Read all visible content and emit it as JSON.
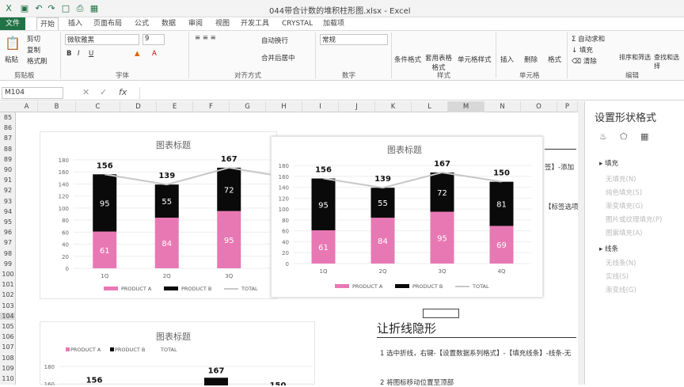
{
  "window": {
    "title": "044带合计数的堆积柱形图.xlsx - Excel"
  },
  "ribbon_tabs": [
    {
      "label": "文件"
    },
    {
      "label": "开始"
    },
    {
      "label": "插入"
    },
    {
      "label": "页面布局"
    },
    {
      "label": "公式"
    },
    {
      "label": "数据"
    },
    {
      "label": "审阅"
    },
    {
      "label": "视图"
    },
    {
      "label": "开发工具"
    },
    {
      "label": "CRYSTAL"
    },
    {
      "label": "加载项"
    }
  ],
  "ribbon": {
    "paste": "粘贴",
    "cut": "剪切",
    "copy": "复制",
    "format_painter": "格式刷",
    "clipboard": "剪贴板",
    "font_name": "微软雅黑",
    "font_size": "9",
    "font_group": "字体",
    "wrap": "自动换行",
    "merge": "合并后居中",
    "align_group": "对齐方式",
    "number_format": "常规",
    "number_group": "数字",
    "cond_format": "条件格式",
    "table_format": "套用表格格式",
    "cell_style": "单元格样式",
    "style_group": "样式",
    "insert": "插入",
    "delete": "删除",
    "format": "格式",
    "cells_group": "单元格",
    "autosum": "自动求和",
    "fill": "填充",
    "clear": "清除",
    "sort": "排序和筛选",
    "find": "查找和选择",
    "edit_group": "编辑"
  },
  "formula_bar": {
    "name_box": "M104"
  },
  "columns": [
    "A",
    "B",
    "C",
    "D",
    "E",
    "F",
    "G",
    "H",
    "I",
    "J",
    "K",
    "L",
    "M",
    "N",
    "O",
    "P"
  ],
  "rows": [
    "85",
    "86",
    "87",
    "88",
    "89",
    "90",
    "91",
    "92",
    "93",
    "94",
    "95",
    "96",
    "97",
    "98",
    "99",
    "100",
    "101",
    "102",
    "103",
    "104",
    "105",
    "106",
    "107",
    "108",
    "109",
    "110"
  ],
  "chart1": {
    "title": "图表标题",
    "legend": [
      "PRODUCT A",
      "PRODUCT B",
      "TOTAL"
    ],
    "y_ticks": [
      "0",
      "20",
      "40",
      "60",
      "80",
      "100",
      "120",
      "140",
      "160",
      "180"
    ]
  },
  "chart2": {
    "title": "图表标题",
    "legend": [
      "PRODUCT A",
      "PRODUCT B",
      "TOTAL"
    ],
    "y_ticks": [
      "0",
      "20",
      "40",
      "60",
      "80",
      "100",
      "120",
      "140",
      "160",
      "180"
    ]
  },
  "chart3": {
    "title": "图表标题",
    "legend": [
      "PRODUCT A",
      "PRODUCT B",
      "TOTAL"
    ],
    "y_ticks": [
      "140",
      "160",
      "180"
    ]
  },
  "chart_data": {
    "type": "bar",
    "categories": [
      "1Q",
      "2Q",
      "3Q",
      "4Q"
    ],
    "series": [
      {
        "name": "PRODUCT A",
        "values": [
          61,
          84,
          95,
          69
        ]
      },
      {
        "name": "PRODUCT B",
        "values": [
          95,
          55,
          72,
          81
        ]
      },
      {
        "name": "TOTAL",
        "values": [
          156,
          139,
          167,
          150
        ]
      }
    ],
    "ylim": [
      0,
      180
    ],
    "colors": {
      "a": "#e878b4",
      "b": "#0a0a0a",
      "total": "#c8c8c8"
    }
  },
  "notes": {
    "heading": "让折线隐形",
    "step1": "1  选中折线，右键-【设置数据系列格式】-【填充线条】-线条-无",
    "step2": "2  将图标移动位置至顶部",
    "side1": "签】-添加",
    "side2": "【标签选项"
  },
  "pane": {
    "title": "设置形状格式",
    "fill": "填充",
    "fill_opts": [
      "无填充(N)",
      "纯色填充(S)",
      "渐变填充(G)",
      "图片或纹理填充(P)",
      "图案填充(A)"
    ],
    "line": "线条",
    "line_opts": [
      "无线条(N)",
      "实线(S)",
      "渐变线(G)"
    ]
  }
}
